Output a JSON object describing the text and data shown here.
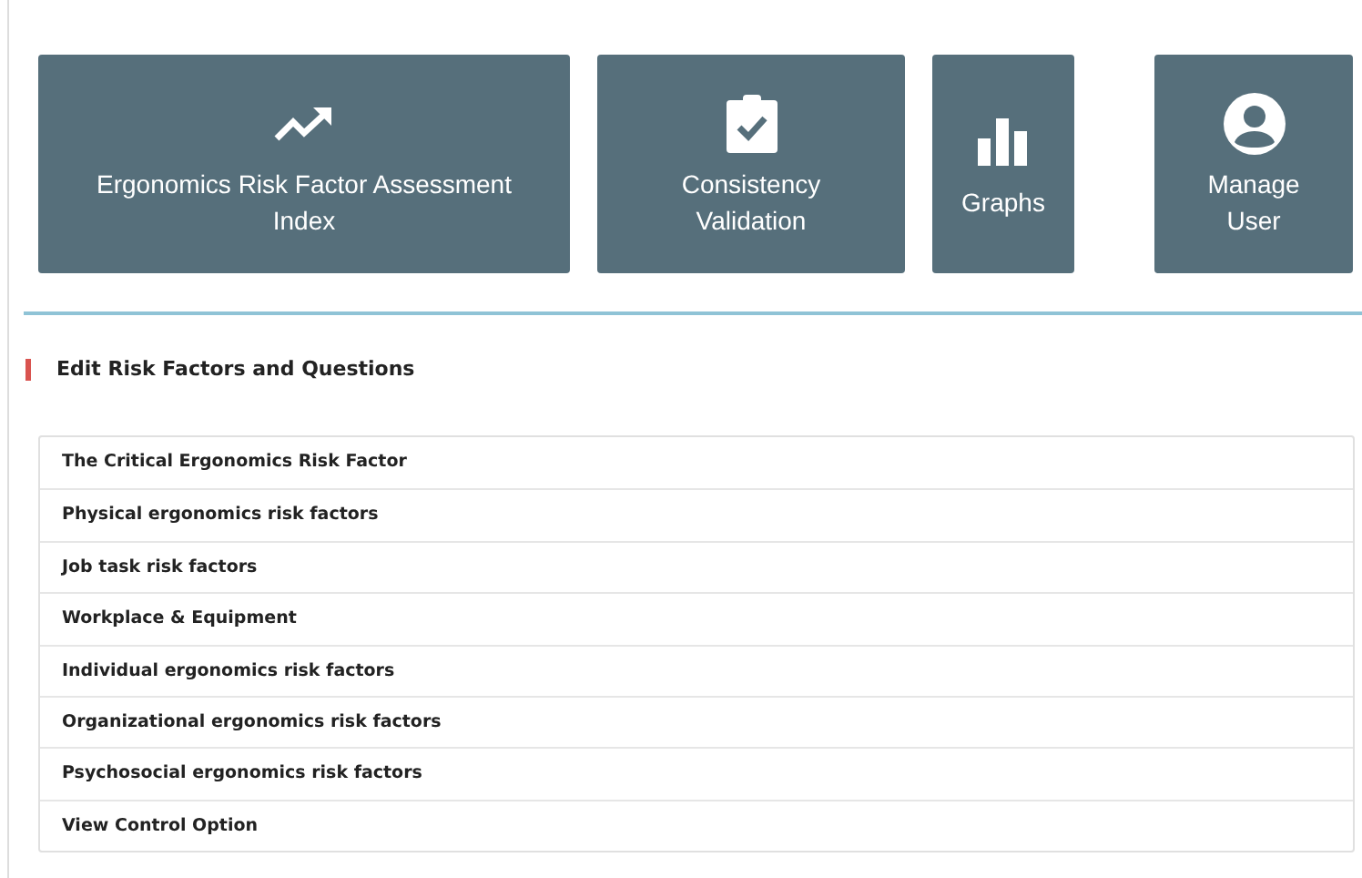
{
  "tiles": [
    {
      "kind": "trend",
      "label": "Ergonomics Risk Factor Assessment Index"
    },
    {
      "kind": "clipboard",
      "label": "Consistency Validation"
    },
    {
      "kind": "bars",
      "label": "Graphs"
    },
    {
      "kind": "user",
      "label": "Manage User"
    }
  ],
  "section": {
    "title": "Edit Risk Factors and Questions"
  },
  "items": [
    "The Critical Ergonomics Risk Factor",
    "Physical ergonomics risk factors",
    "Job task risk factors",
    "Workplace & Equipment",
    "Individual ergonomics risk factors",
    "Organizational ergonomics risk factors",
    "Psychosocial ergonomics risk factors",
    "View Control Option"
  ]
}
